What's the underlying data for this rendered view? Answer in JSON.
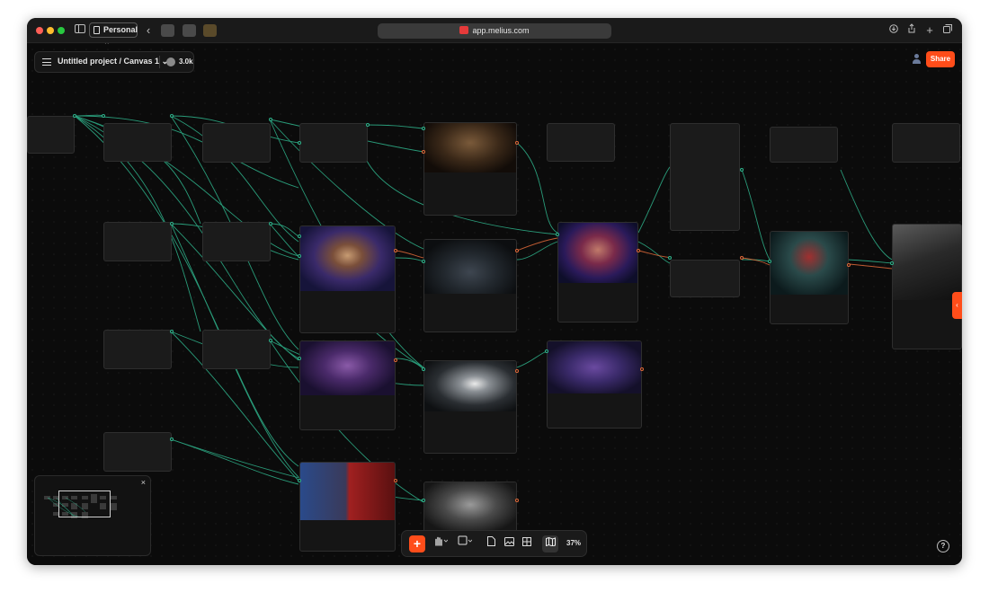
{
  "browser": {
    "profile_label": "Personal",
    "url": "app.melius.com"
  },
  "header": {
    "project_name": "Untitled project /",
    "canvas_name": "Canvas 1",
    "credits": "3.0k",
    "share_label": "Share"
  },
  "toolbar": {
    "zoom": "37%"
  },
  "icons": {
    "back": "chevron-left-icon",
    "sidebar": "sidebar-toggle-icon",
    "download": "download-icon",
    "share": "share-icon",
    "new_tab": "plus-icon",
    "tabs": "tabs-overview-icon",
    "menu": "hamburger-icon",
    "add": "plus-icon",
    "hand": "hand-tool-icon",
    "sticky": "sticky-note-icon",
    "document": "document-icon",
    "image": "image-icon",
    "table": "grid-icon",
    "map": "map-icon",
    "help": "question-icon",
    "close": "close-icon"
  },
  "colors": {
    "accent": "#ff4d1a",
    "edge_green": "#2fb58d",
    "edge_orange": "#e06a3a"
  }
}
